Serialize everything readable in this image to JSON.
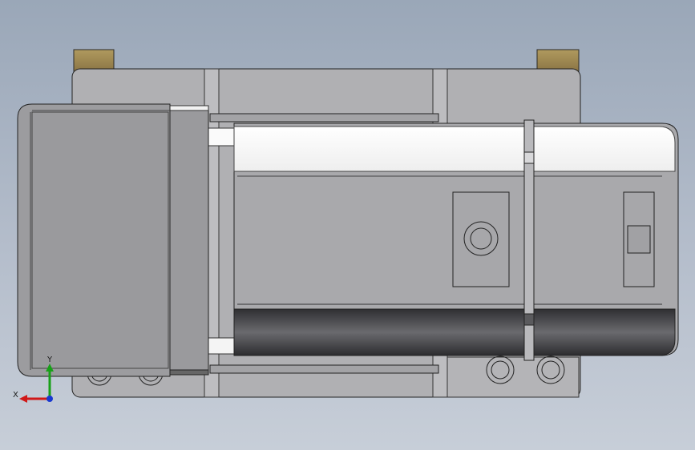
{
  "view": {
    "background_top": "#9aa7b8",
    "background_bottom": "#c7ced8"
  },
  "triad": {
    "x_label": "X",
    "y_label": "Y",
    "x_color": "#d01818",
    "y_color": "#18a018",
    "z_color": "#1838d0"
  },
  "model": {
    "body_color": "#a9a9ac",
    "tab_color": "#9a8450",
    "highlight_color": "#ffffff",
    "dark_rail_color": "#454548"
  }
}
